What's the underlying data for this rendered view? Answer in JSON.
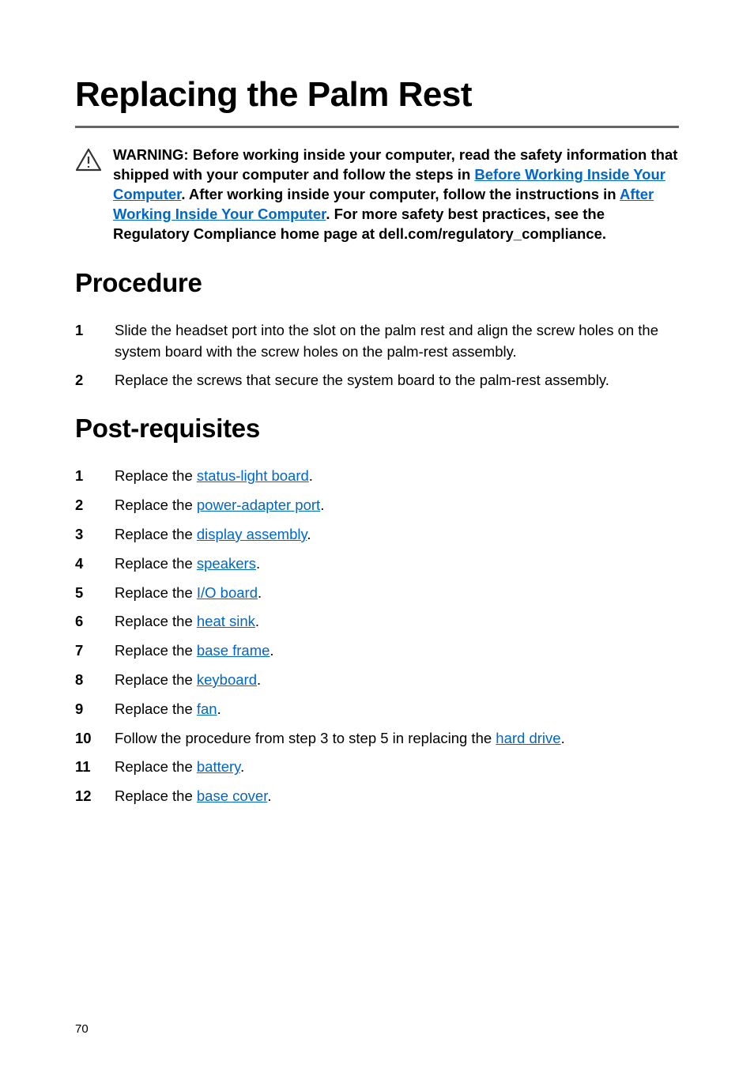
{
  "title": "Replacing the Palm Rest",
  "warning": {
    "prefix": "WARNING: Before working inside your computer, read the safety information that shipped with your computer and follow the steps in ",
    "link1": "Before Working Inside Your Computer",
    "mid1": ". After working inside your computer, follow the instructions in ",
    "link2": "After Working Inside Your Computer",
    "suffix": ". For more safety best practices, see the Regulatory Compliance home page at dell.com/regulatory_compliance."
  },
  "sections": {
    "procedure": {
      "heading": "Procedure",
      "items": [
        {
          "num": "1",
          "text": "Slide the headset port into the slot on the palm rest and align the screw holes on the system board with the screw holes on the palm-rest assembly."
        },
        {
          "num": "2",
          "text": "Replace the screws that secure the system board to the palm-rest assembly."
        }
      ]
    },
    "post": {
      "heading": "Post-requisites",
      "items": [
        {
          "num": "1",
          "pre": "Replace the ",
          "link": "status-light board",
          "post": "."
        },
        {
          "num": "2",
          "pre": "Replace the ",
          "link": "power-adapter port",
          "post": "."
        },
        {
          "num": "3",
          "pre": "Replace the ",
          "link": "display assembly",
          "post": "."
        },
        {
          "num": "4",
          "pre": "Replace the ",
          "link": "speakers",
          "post": "."
        },
        {
          "num": "5",
          "pre": "Replace the ",
          "link": "I/O board",
          "post": "."
        },
        {
          "num": "6",
          "pre": "Replace the ",
          "link": "heat sink",
          "post": "."
        },
        {
          "num": "7",
          "pre": "Replace the ",
          "link": "base frame",
          "post": "."
        },
        {
          "num": "8",
          "pre": "Replace the ",
          "link": "keyboard",
          "post": "."
        },
        {
          "num": "9",
          "pre": "Replace the ",
          "link": "fan",
          "post": "."
        },
        {
          "num": "10",
          "pre": "Follow the procedure from step 3 to step 5 in replacing the ",
          "link": "hard drive",
          "post": "."
        },
        {
          "num": "11",
          "pre": "Replace the ",
          "link": "battery",
          "post": "."
        },
        {
          "num": "12",
          "pre": "Replace the ",
          "link": "base cover",
          "post": "."
        }
      ]
    }
  },
  "page_number": "70"
}
